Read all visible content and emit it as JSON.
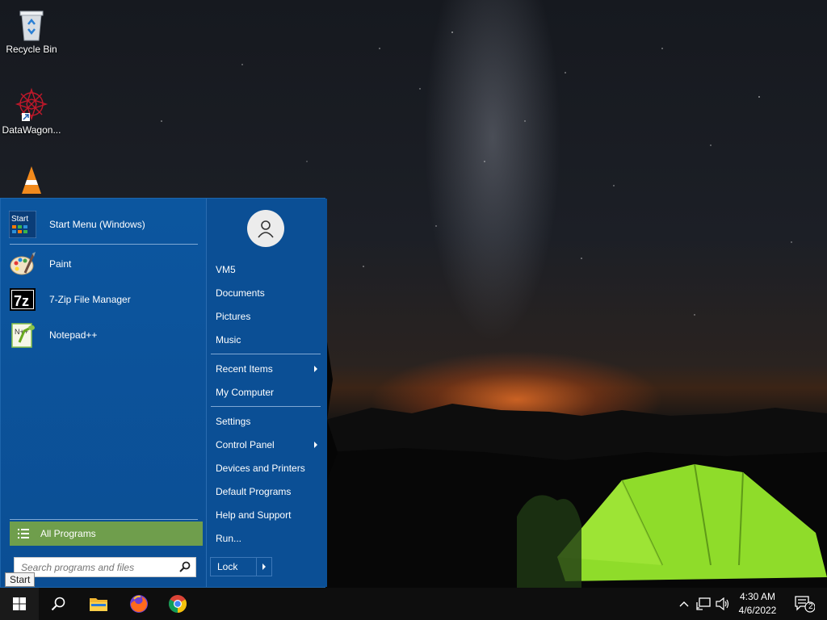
{
  "desktop": {
    "icons": [
      {
        "label": "Recycle Bin",
        "icon": "recycle-bin-icon"
      },
      {
        "label": "DataWagon...",
        "icon": "datawagon-icon"
      },
      {
        "label": "",
        "icon": "vlc-icon"
      }
    ]
  },
  "start_menu": {
    "pinned": [
      {
        "label": "Start Menu (Windows)",
        "icon": "start-menu-app-icon"
      },
      {
        "label": "Paint",
        "icon": "paint-icon"
      },
      {
        "label": "7-Zip File Manager",
        "icon": "7zip-icon"
      },
      {
        "label": "Notepad++",
        "icon": "notepadpp-icon"
      }
    ],
    "all_programs": "All Programs",
    "search_placeholder": "Search programs and files",
    "right_items": {
      "user": "VM5",
      "documents": "Documents",
      "pictures": "Pictures",
      "music": "Music",
      "recent_items": "Recent Items",
      "my_computer": "My Computer",
      "settings": "Settings",
      "control_panel": "Control Panel",
      "devices_printers": "Devices and Printers",
      "default_programs": "Default Programs",
      "help_support": "Help and Support",
      "run": "Run..."
    },
    "lock": "Lock",
    "start_icon_text": "Start"
  },
  "tooltip": "Start",
  "taskbar": {
    "time": "4:30 AM",
    "date": "4/6/2022",
    "notification_count": "2"
  },
  "colors": {
    "menu_bg": "#0b4f95",
    "all_programs_bg": "#6f9e4c",
    "taskbar_bg": "#0e0e0e",
    "tent": "#8fdc2a"
  }
}
